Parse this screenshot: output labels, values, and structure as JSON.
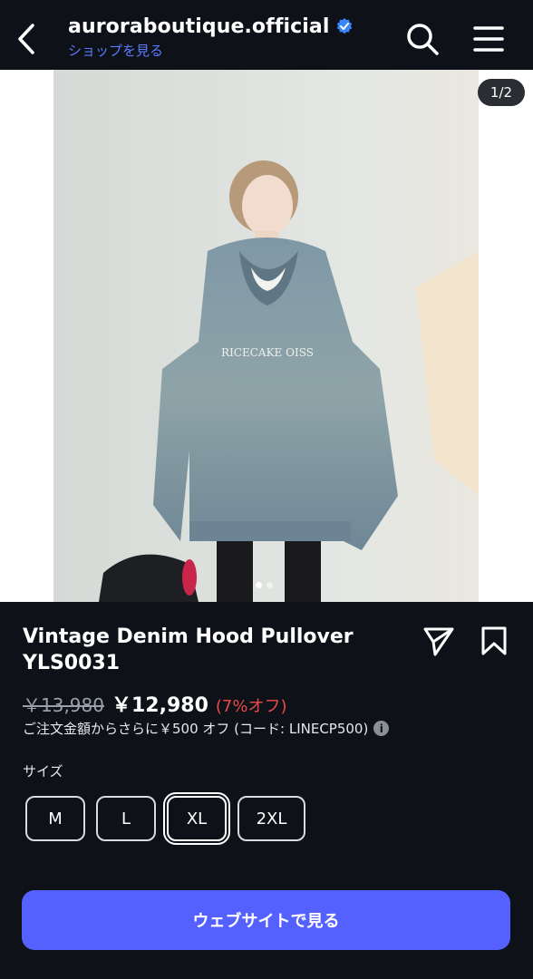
{
  "header": {
    "shop_name": "auroraboutique.official",
    "shop_link": "ショップを見る"
  },
  "gallery": {
    "counter": "1/2",
    "print_text": "RICECAKE OISS",
    "current_index": 1,
    "total": 2
  },
  "product": {
    "title": "Vintage Denim Hood Pullover YLS0031",
    "old_price": "￥13,980",
    "new_price": "￥12,980",
    "discount": "(7%オフ)",
    "promo": "ご注文金額からさらに￥500 オフ (コード: LINECP500)"
  },
  "sizes": {
    "label": "サイズ",
    "options": [
      "M",
      "L",
      "XL",
      "2XL"
    ],
    "selected": "XL"
  },
  "cta": {
    "label": "ウェブサイトで見る"
  },
  "colors": {
    "background": "#0e1218",
    "accent": "#5561ff",
    "link": "#5b7bff",
    "discount": "#e94b4b"
  }
}
